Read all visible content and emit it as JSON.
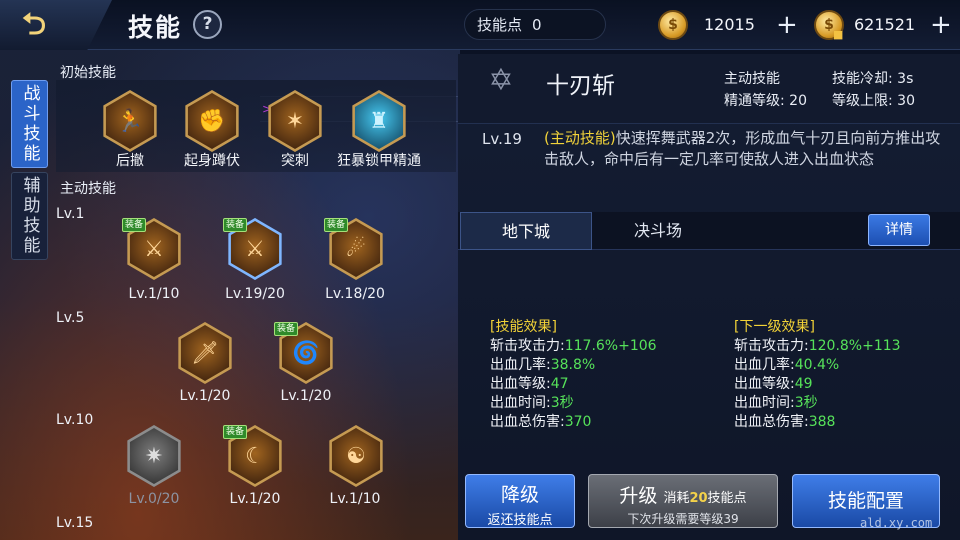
{
  "header": {
    "back_icon": "back-arrow-icon",
    "title": "技能",
    "help_label": "?",
    "skill_points_label": "技能点",
    "skill_points_value": "0",
    "gold_value": "12015",
    "bound_gold_value": "621521",
    "plus_label": "+"
  },
  "side_tabs": [
    {
      "label": "战斗技能",
      "active": true
    },
    {
      "label": "辅助技能",
      "active": false
    }
  ],
  "initial_skills": {
    "heading": "初始技能",
    "items": [
      {
        "name": "后撤",
        "icon": "retreat-icon"
      },
      {
        "name": "起身蹲伏",
        "icon": "rise-crouch-icon"
      },
      {
        "name": "突刺",
        "icon": "thrust-icon"
      },
      {
        "name": "狂暴锁甲精通",
        "icon": "berserk-armor-icon"
      }
    ]
  },
  "active_skills": {
    "heading": "主动技能",
    "equip_label": "装备",
    "rows": [
      {
        "level": "Lv.1",
        "skills": [
          {
            "lv": "Lv.1/10",
            "equipped": true,
            "selected": false
          },
          {
            "lv": "Lv.19/20",
            "equipped": true,
            "selected": true
          },
          {
            "lv": "Lv.18/20",
            "equipped": true,
            "selected": false
          }
        ]
      },
      {
        "level": "Lv.5",
        "skills": [
          {
            "lv": "Lv.1/20",
            "equipped": false,
            "selected": false
          },
          {
            "lv": "Lv.1/20",
            "equipped": true,
            "selected": false
          }
        ]
      },
      {
        "level": "Lv.10",
        "skills": [
          {
            "lv": "Lv.0/20",
            "equipped": false,
            "selected": false,
            "locked": true
          },
          {
            "lv": "Lv.1/20",
            "equipped": true,
            "selected": false
          },
          {
            "lv": "Lv.1/10",
            "equipped": false,
            "selected": false
          }
        ]
      },
      {
        "level": "Lv.15",
        "skills": []
      }
    ]
  },
  "detail": {
    "icon": "hexagram-icon",
    "name": "十刃斩",
    "type": "主动技能",
    "cooldown_label": "技能冷却:",
    "cooldown": "3s",
    "mastery_label": "精通等级:",
    "mastery": "20",
    "max_label": "等级上限:",
    "max": "30",
    "current_lv": "Lv.19",
    "desc_tag": "(主动技能)",
    "desc": "快速挥舞武器2次，形成血气十刃且向前方推出攻击敌人，命中后有一定几率可使敌人进入出血状态",
    "tabs": [
      "地下城",
      "决斗场"
    ],
    "detail_button": "详情",
    "effects": {
      "heading": "[技能效果]",
      "lines": [
        {
          "label": "斩击攻击力:",
          "value": "117.6%+106"
        },
        {
          "label": "出血几率:",
          "value": "38.8%"
        },
        {
          "label": "出血等级:",
          "value": "47"
        },
        {
          "label": "出血时间:",
          "value": "3秒"
        },
        {
          "label": "出血总伤害:",
          "value": "370"
        }
      ]
    },
    "next_effects": {
      "heading": "[下一级效果]",
      "lines": [
        {
          "label": "斩击攻击力:",
          "value": "120.8%+113"
        },
        {
          "label": "出血几率:",
          "value": "40.4%"
        },
        {
          "label": "出血等级:",
          "value": "49"
        },
        {
          "label": "出血时间:",
          "value": "3秒"
        },
        {
          "label": "出血总伤害:",
          "value": "388"
        }
      ]
    }
  },
  "buttons": {
    "downgrade": "降级",
    "downgrade_sub": "返还技能点",
    "upgrade": "升级",
    "upgrade_cost_prefix": "消耗",
    "upgrade_cost": "20",
    "upgrade_cost_suffix": "技能点",
    "upgrade_sub": "下次升级需要等级39",
    "config": "技能配置"
  },
  "watermark": "ald.xy.com"
}
